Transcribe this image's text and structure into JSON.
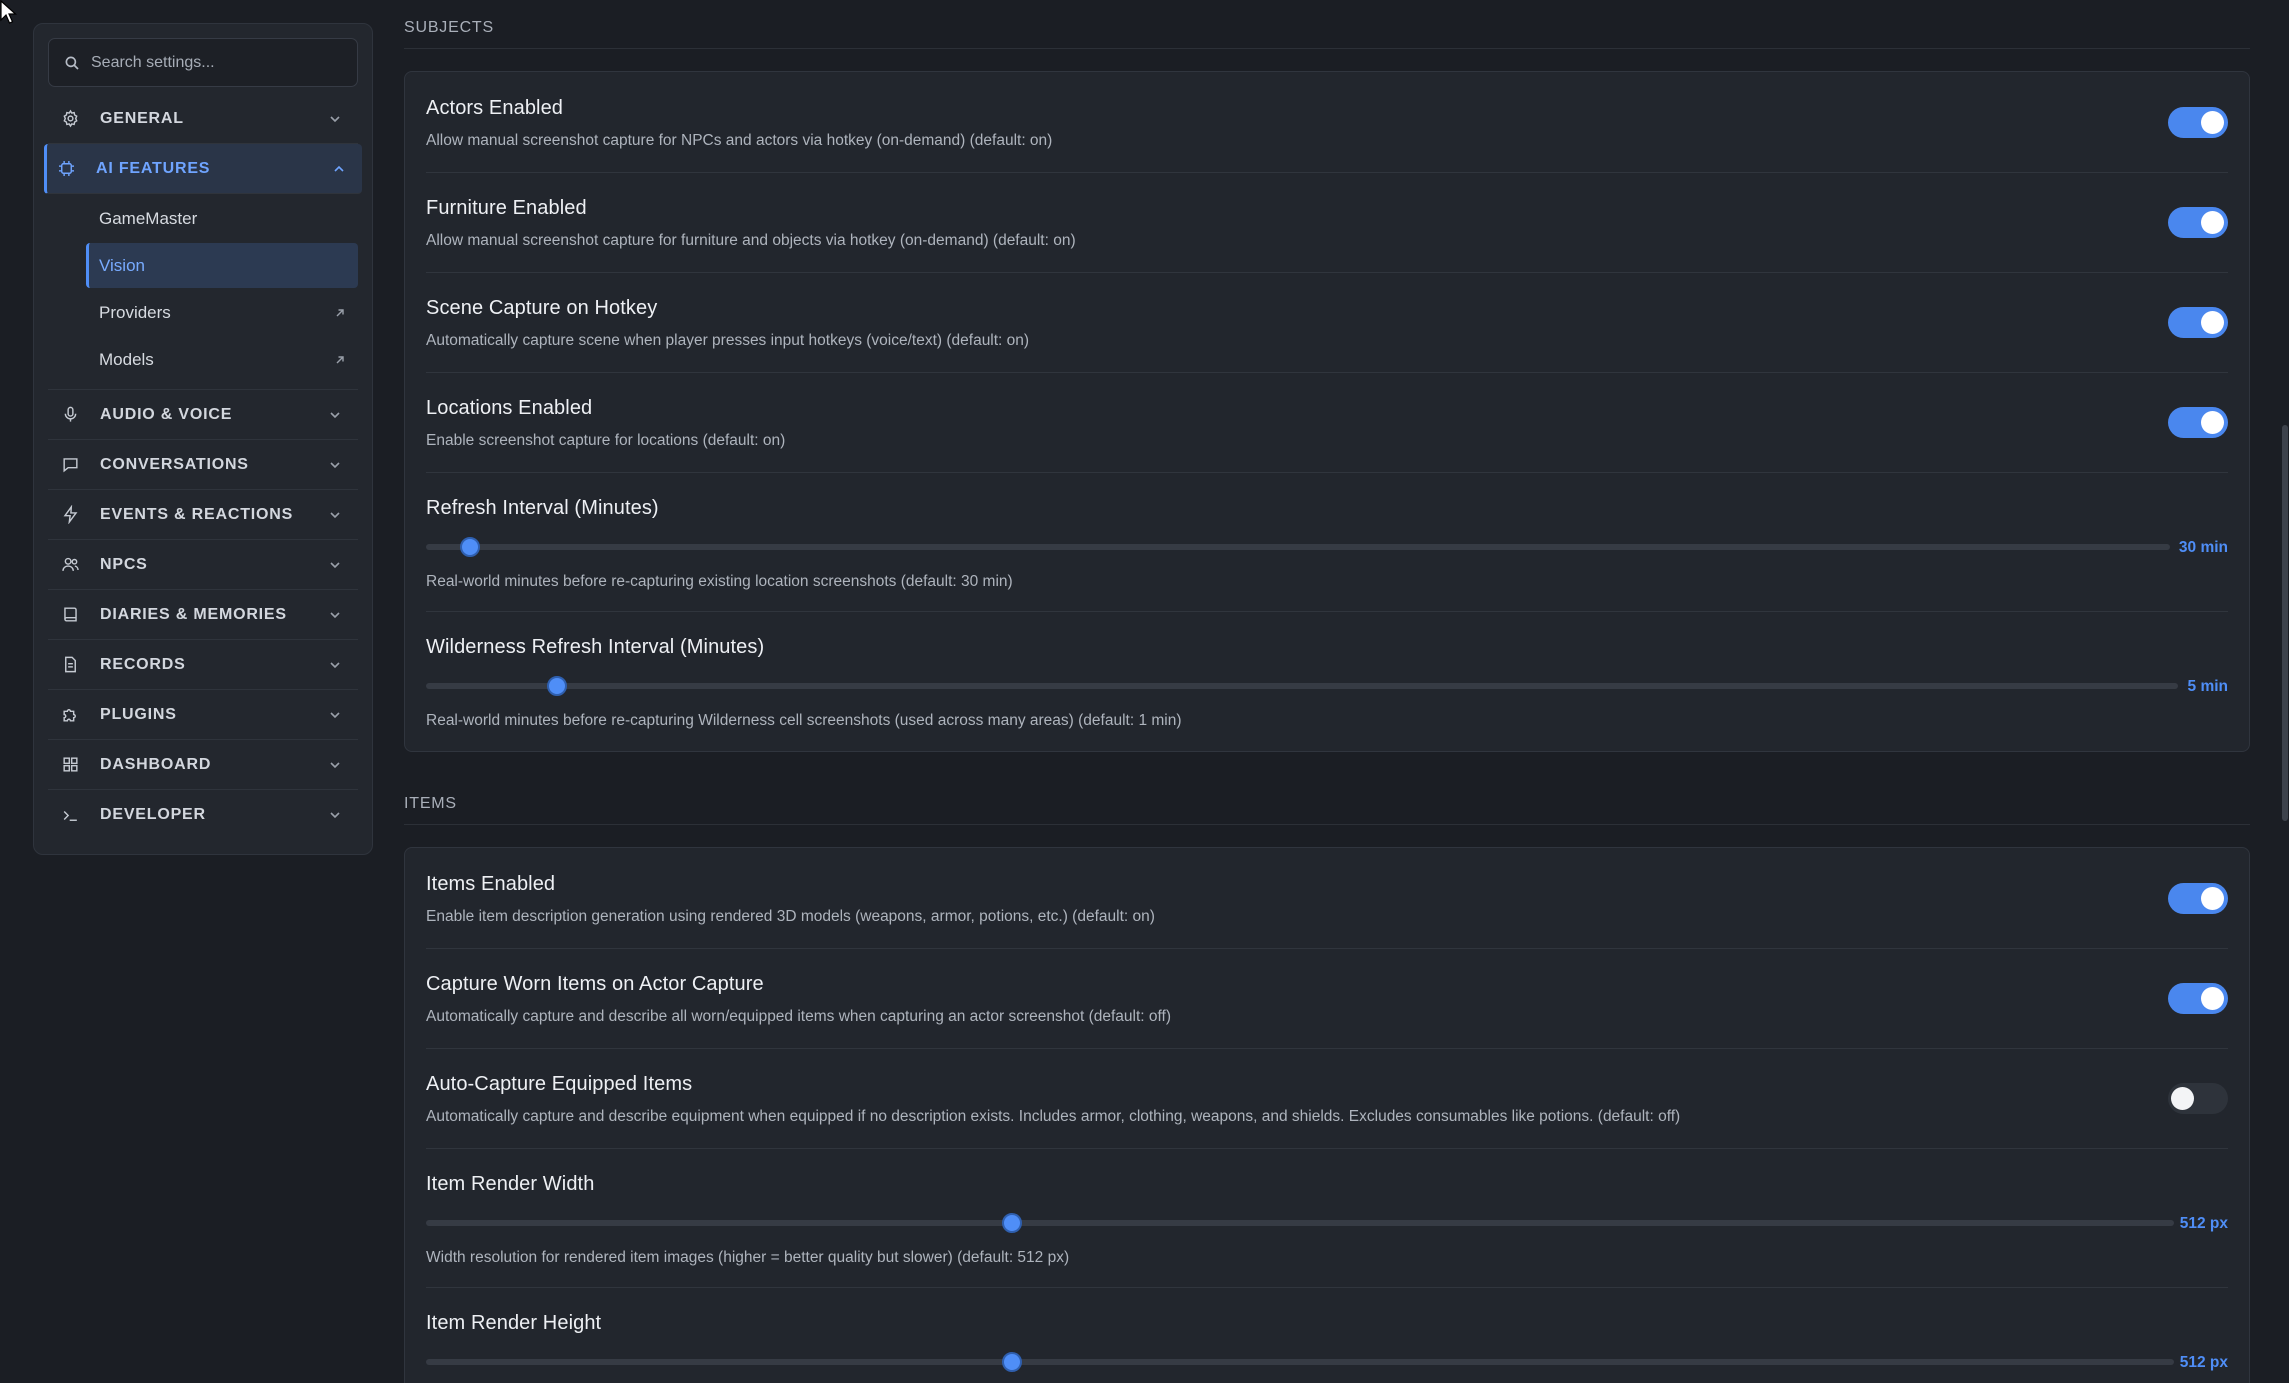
{
  "search": {
    "placeholder": "Search settings..."
  },
  "sidebar": {
    "items": [
      {
        "label": "GENERAL",
        "icon": "gear-icon"
      },
      {
        "label": "AI FEATURES",
        "icon": "cpu-icon",
        "expanded": true,
        "children": [
          {
            "label": "GameMaster"
          },
          {
            "label": "Vision",
            "selected": true
          },
          {
            "label": "Providers",
            "external": true
          },
          {
            "label": "Models",
            "external": true
          }
        ]
      },
      {
        "label": "AUDIO & VOICE",
        "icon": "microphone-icon"
      },
      {
        "label": "CONVERSATIONS",
        "icon": "chat-bubble-icon"
      },
      {
        "label": "EVENTS & REACTIONS",
        "icon": "lightning-icon"
      },
      {
        "label": "NPCS",
        "icon": "users-icon"
      },
      {
        "label": "DIARIES & MEMORIES",
        "icon": "book-icon"
      },
      {
        "label": "RECORDS",
        "icon": "document-icon"
      },
      {
        "label": "PLUGINS",
        "icon": "puzzle-icon"
      },
      {
        "label": "DASHBOARD",
        "icon": "grid-icon"
      },
      {
        "label": "DEVELOPER",
        "icon": "terminal-icon"
      }
    ]
  },
  "sections": {
    "subjects": {
      "title": "SUBJECTS",
      "actors": {
        "title": "Actors Enabled",
        "desc": "Allow manual screenshot capture for NPCs and actors via hotkey (on-demand) (default: on)",
        "on": true
      },
      "furniture": {
        "title": "Furniture Enabled",
        "desc": "Allow manual screenshot capture for furniture and objects via hotkey (on-demand) (default: on)",
        "on": true
      },
      "scene": {
        "title": "Scene Capture on Hotkey",
        "desc": "Automatically capture scene when player presses input hotkeys (voice/text) (default: on)",
        "on": true
      },
      "locations": {
        "title": "Locations Enabled",
        "desc": "Enable screenshot capture for locations (default: on)",
        "on": true
      },
      "refresh": {
        "title": "Refresh Interval (Minutes)",
        "desc": "Real-world minutes before re-capturing existing location screenshots (default: 30 min)",
        "value_label": "30 min",
        "fraction": 0.025
      },
      "wilderness": {
        "title": "Wilderness Refresh Interval (Minutes)",
        "desc": "Real-world minutes before re-capturing Wilderness cell screenshots (used across many areas) (default: 1 min)",
        "value_label": "5 min",
        "fraction": 0.075
      }
    },
    "items": {
      "title": "ITEMS",
      "items_enabled": {
        "title": "Items Enabled",
        "desc": "Enable item description generation using rendered 3D models (weapons, armor, potions, etc.) (default: on)",
        "on": true
      },
      "worn": {
        "title": "Capture Worn Items on Actor Capture",
        "desc": "Automatically capture and describe all worn/equipped items when capturing an actor screenshot (default: off)",
        "on": true
      },
      "auto_equipped": {
        "title": "Auto-Capture Equipped Items",
        "desc": "Automatically capture and describe equipment when equipped if no description exists. Includes armor, clothing, weapons, and shields. Excludes consumables like potions. (default: off)",
        "on": false
      },
      "render_width": {
        "title": "Item Render Width",
        "desc": "Width resolution for rendered item images (higher = better quality but slower) (default: 512 px)",
        "value_label": "512 px",
        "fraction": 0.335
      },
      "render_height": {
        "title": "Item Render Height",
        "value_label": "512 px",
        "fraction": 0.335
      }
    }
  },
  "colors": {
    "accent": "#4f8ef7",
    "background": "#1b1e24",
    "card": "#22262d"
  }
}
